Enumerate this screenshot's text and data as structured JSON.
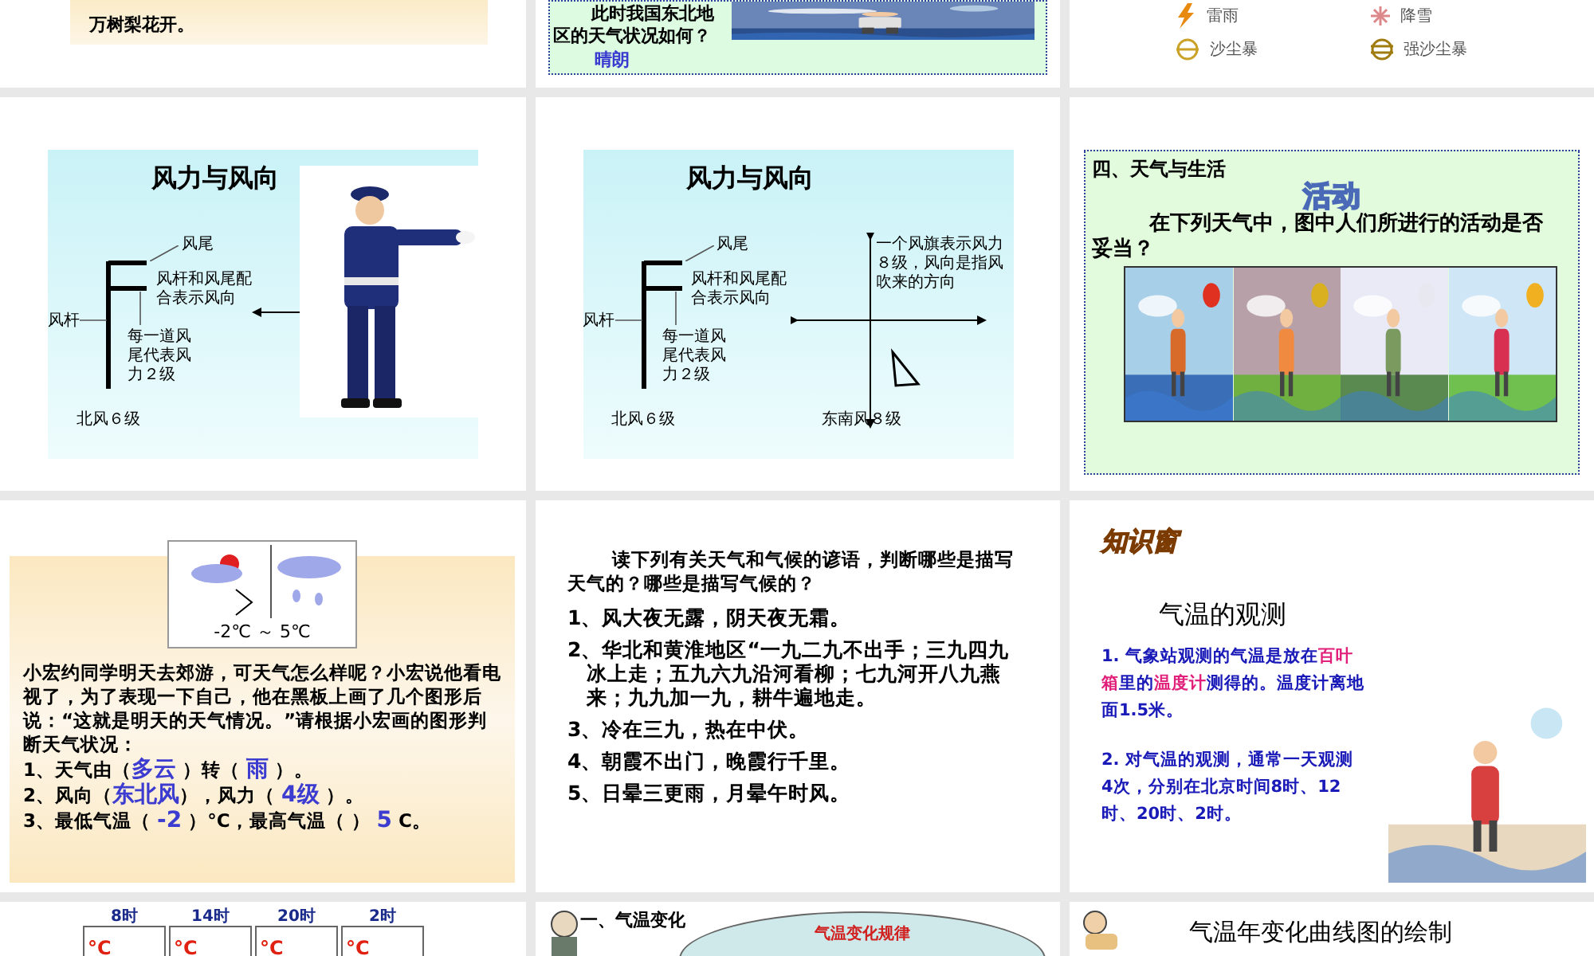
{
  "row_1": [
    {
      "kind": "text_panel",
      "text": "万树梨花开。"
    },
    {
      "kind": "question",
      "question": "此时我国东北地区的天气状况如何？",
      "answer": "晴朗"
    },
    {
      "kind": "legend",
      "items": [
        {
          "label": "雷雨"
        },
        {
          "label": "降雪"
        },
        {
          "label": "沙尘暴"
        },
        {
          "label": "强沙尘暴"
        }
      ]
    }
  ],
  "row_2": [
    {
      "kind": "wind_police",
      "title": "风力与风向",
      "tail": "风尾",
      "combo": "风杆和风尾配合表示风向",
      "staff": "风杆",
      "each": "每一道风尾代表风力２级",
      "caption": "北风６级"
    },
    {
      "kind": "wind_cross",
      "title": "风力与风向",
      "tail": "风尾",
      "combo": "风杆和风尾配合表示风向",
      "staff": "风杆",
      "each": "每一道风尾代表风力２级",
      "caption": "北风６级",
      "flag_note": "一个风旗表示风力８级，风向是指风吹来的方向",
      "caption_2": "东南风８级"
    },
    {
      "kind": "activity",
      "heading": "四、天气与生活",
      "badge": "活动",
      "question": "在下列天气中，图中人们所进行的活动是否妥当？"
    }
  ],
  "row_3": [
    {
      "kind": "forecast",
      "temperature": "-2℃ ～ 5℃",
      "story": "小宏约同学明天去郊游，可天气怎么样呢？小宏说他看电视了，为了表现一下自己，他在黑板上画了几个图形后说：“这就是明天的天气情况。”请根据小宏画的图形判断天气状况：",
      "lines": [
        [
          {
            "kind": "text",
            "text": "1、天气由（"
          },
          {
            "kind": "answer",
            "text": "多云"
          },
          {
            "kind": "text",
            "text": " ）转（ "
          },
          {
            "kind": "answer",
            "text": "雨"
          },
          {
            "kind": "text",
            "text": " ）。"
          }
        ],
        [
          {
            "kind": "text",
            "text": "2、风向（"
          },
          {
            "kind": "answer",
            "text": "东北风"
          },
          {
            "kind": "text",
            "text": "），风力（ "
          },
          {
            "kind": "answer",
            "text": "4级"
          },
          {
            "kind": "text",
            "text": " ）。"
          }
        ],
        [
          {
            "kind": "text",
            "text": "3、最低气温（ "
          },
          {
            "kind": "answer",
            "text": "-2"
          },
          {
            "kind": "text",
            "text": " ）°C，最高气温（ ） "
          },
          {
            "kind": "answer",
            "text": "5"
          },
          {
            "kind": "text",
            "text": " C。"
          }
        ]
      ]
    },
    {
      "kind": "proverbs",
      "intro": "读下列有关天气和气候的谚语，判断哪些是描写天气的？哪些是描写气候的？",
      "items": [
        "1、风大夜无露，阴天夜无霜。",
        "2、华北和黄淮地区“一九二九不出手；三九四九冰上走；五九六九沿河看柳；七九河开八九燕来；九九加一九，耕牛遍地走。",
        "3、冷在三九，热在中伏。",
        "4、朝霞不出门，晚霞行千里。",
        "5、日晕三更雨，月晕午时风。"
      ]
    },
    {
      "kind": "knowledge",
      "logo": "知识窗",
      "title": "气温的观测",
      "paragraphs": [
        [
          {
            "kind": "text",
            "text": "1. 气象站观测的气温是放在"
          },
          {
            "kind": "highlight",
            "text": "百叶箱"
          },
          {
            "kind": "text",
            "text": "里的"
          },
          {
            "kind": "highlight",
            "text": "温度计"
          },
          {
            "kind": "text",
            "text": "测得的。温度计离地面1.5米。"
          }
        ],
        [
          {
            "kind": "text",
            "text": "2. 对气温的观测，通常一天观测4次，分别在北京时间8时、12时、20时、2时。"
          }
        ]
      ]
    }
  ],
  "row_4": [
    {
      "kind": "times",
      "times": [
        "8时",
        "14时",
        "20时",
        "2时"
      ],
      "units": [
        "°C",
        "°C",
        "°C",
        "°C"
      ]
    },
    {
      "kind": "change",
      "heading": "一、气温变化",
      "note_title": "气温变化规律"
    },
    {
      "kind": "annual",
      "title": "气温年变化曲线图的绘制"
    }
  ]
}
